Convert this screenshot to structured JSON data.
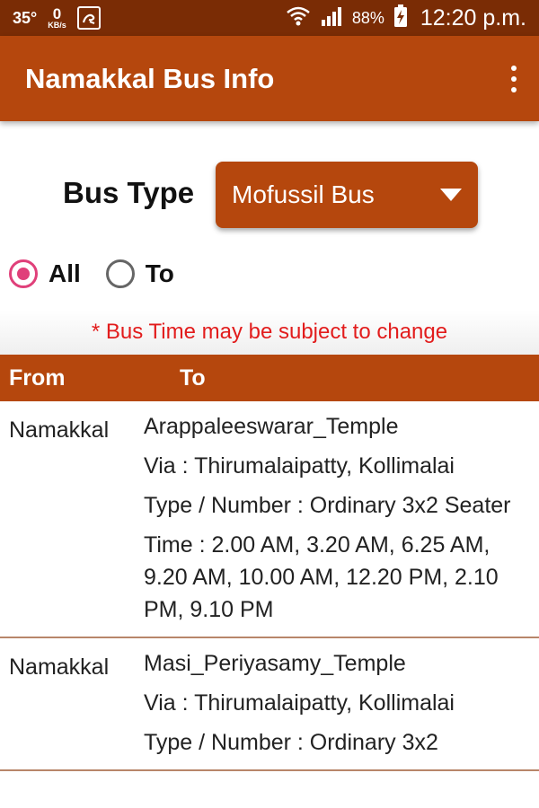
{
  "status_bar": {
    "temperature": "35°",
    "net_speed": "0",
    "net_speed_unit": "KB/s",
    "battery_percent": "88%",
    "time": "12:20 p.m."
  },
  "app_bar": {
    "title": "Namakkal Bus Info"
  },
  "bus_type": {
    "label": "Bus Type",
    "selected": "Mofussil Bus"
  },
  "filters": [
    {
      "label": "All",
      "checked": true
    },
    {
      "label": "To",
      "checked": false
    }
  ],
  "notice": "* Bus Time may be subject to change",
  "table": {
    "headers": {
      "from": "From",
      "to": "To"
    },
    "rows": [
      {
        "from": "Namakkal",
        "to": "Arappaleeswarar_Temple",
        "via": "Via : Thirumalaipatty, Kollimalai",
        "type": "Type / Number :  Ordinary 3x2 Seater",
        "time": "Time : 2.00 AM,  3.20 AM,  6.25 AM,  9.20 AM,  10.00 AM,  12.20 PM,  2.10 PM,  9.10 PM"
      },
      {
        "from": "Namakkal",
        "to": "Masi_Periyasamy_Temple",
        "via": "Via : Thirumalaipatty, Kollimalai",
        "type": "Type / Number :  Ordinary 3x2"
      }
    ]
  },
  "colors": {
    "status_bar": "#7a2c05",
    "primary": "#b5470d",
    "radio_accent": "#e0407a",
    "notice_text": "#e21c1c"
  },
  "icons": {
    "app_notification": "app-notification-icon",
    "wifi": "wifi-icon",
    "signal": "signal-icon",
    "battery": "battery-charging-icon",
    "overflow_menu": "more-vert-icon",
    "dropdown": "caret-down-icon"
  }
}
